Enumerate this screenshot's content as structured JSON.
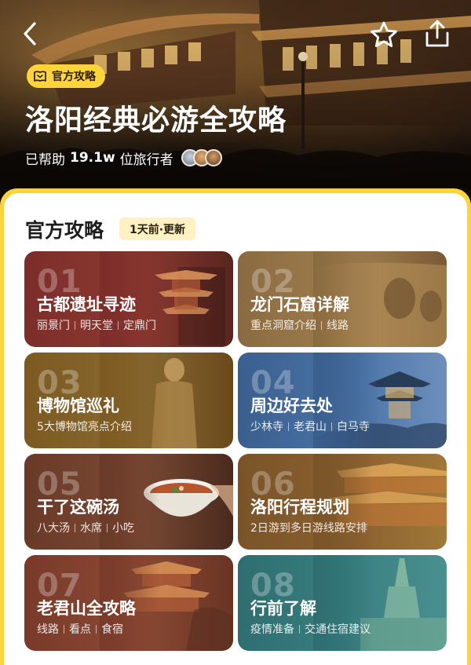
{
  "header": {
    "badge_label": "官方攻略",
    "title": "洛阳经典必游全攻略",
    "helped_prefix": "已帮助",
    "helped_count": "19.1w",
    "helped_suffix": "位旅行者"
  },
  "icons": {
    "back": "chevron-left-icon",
    "favorite": "star-icon",
    "share": "share-icon",
    "badge": "guide-book-icon"
  },
  "colors": {
    "accent": "#ffd43b",
    "tag_bg": "#fff1c2"
  },
  "section": {
    "title": "官方攻略",
    "update_tag": "1天前·更新"
  },
  "cards": [
    {
      "num": "01",
      "title": "古都遗址寻迹",
      "tags": [
        "丽景门",
        "明天堂",
        "定鼎门"
      ]
    },
    {
      "num": "02",
      "title": "龙门石窟详解",
      "tags": [
        "重点洞窟介绍",
        "线路"
      ]
    },
    {
      "num": "03",
      "title": "博物馆巡礼",
      "tags": [
        "5大博物馆亮点介绍"
      ]
    },
    {
      "num": "04",
      "title": "周边好去处",
      "tags": [
        "少林寺",
        "老君山",
        "白马寺"
      ]
    },
    {
      "num": "05",
      "title": "干了这碗汤",
      "tags": [
        "八大汤",
        "水席",
        "小吃"
      ]
    },
    {
      "num": "06",
      "title": "洛阳行程规划",
      "tags": [
        "2日游到多日游线路安排"
      ]
    },
    {
      "num": "07",
      "title": "老君山全攻略",
      "tags": [
        "线路",
        "看点",
        "食宿"
      ]
    },
    {
      "num": "08",
      "title": "行前了解",
      "tags": [
        "疫情准备",
        "交通住宿建议"
      ]
    }
  ]
}
